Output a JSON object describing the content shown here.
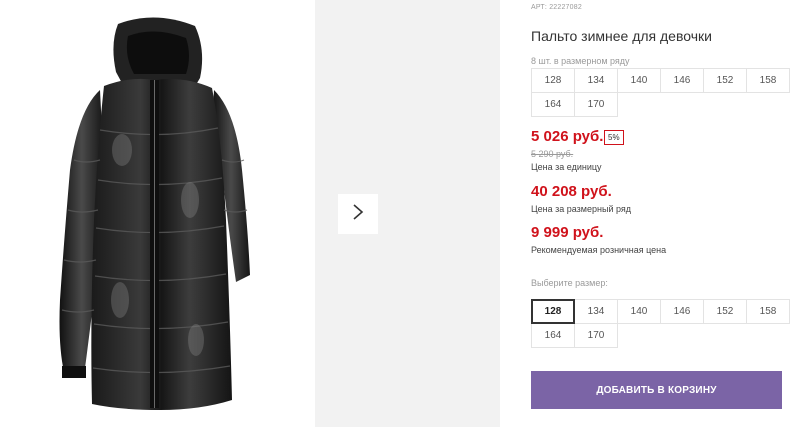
{
  "product": {
    "sku_text": "АРТ: 22227082",
    "title": "Пальто зимнее для девочки"
  },
  "size_row": {
    "hint": "8 шт. в размерном ряду",
    "sizes": [
      "128",
      "134",
      "140",
      "146",
      "152",
      "158",
      "164",
      "170"
    ]
  },
  "prices": {
    "unit_price": "5 026 руб.",
    "discount": "5%",
    "old_price": "5 290 руб.",
    "unit_caption": "Цена за единицу",
    "row_price": "40 208 руб.",
    "row_caption": "Цена за размерный ряд",
    "rrp": "9 999 руб.",
    "rrp_caption": "Рекомендуемая розничная цена"
  },
  "size_picker": {
    "hint": "Выберите размер:",
    "sizes": [
      "128",
      "134",
      "140",
      "146",
      "152",
      "158",
      "164",
      "170"
    ],
    "selected": "128"
  },
  "cart": {
    "label": "ДОБАВИТЬ В КОРЗИНУ",
    "button_color": "#7b64a6"
  },
  "gallery": {
    "next_icon": "chevron-right-icon",
    "image_subject": "black-puffer-coat"
  },
  "colors": {
    "price_red": "#d0121b",
    "muted_text": "#9a9a9a"
  }
}
